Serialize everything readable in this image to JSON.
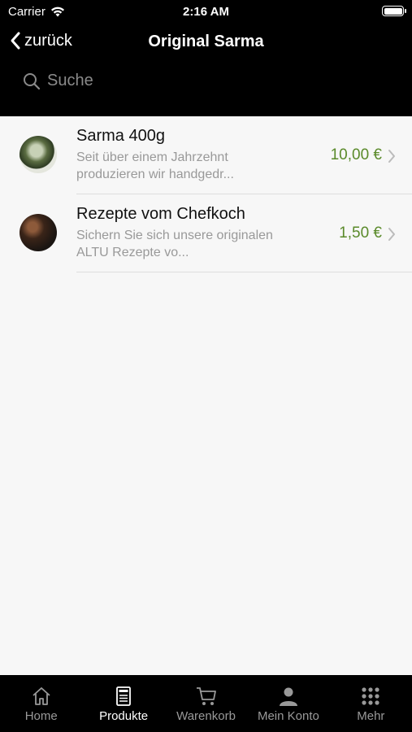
{
  "status_bar": {
    "carrier": "Carrier",
    "time": "2:16 AM",
    "battery_level": 1.0
  },
  "header": {
    "back_label": "zurück",
    "title": "Original Sarma"
  },
  "search": {
    "placeholder": "Suche",
    "value": ""
  },
  "products": [
    {
      "title": "Sarma 400g",
      "desc_line1": "Seit über einem Jahrzehnt",
      "desc_line2": "produzieren wir handgedr...",
      "price": "10,00 €"
    },
    {
      "title": "Rezepte vom Chefkoch",
      "desc_line1": "Sichern Sie sich unsere originalen",
      "desc_line2": "ALTU Rezepte vo...",
      "price": "1,50 €"
    }
  ],
  "tabs": [
    {
      "label": "Home",
      "icon": "home-icon",
      "active": false
    },
    {
      "label": "Produkte",
      "icon": "menu-card-icon",
      "active": true
    },
    {
      "label": "Warenkorb",
      "icon": "cart-icon",
      "active": false
    },
    {
      "label": "Mein Konto",
      "icon": "person-icon",
      "active": false
    },
    {
      "label": "Mehr",
      "icon": "grid-dots-icon",
      "active": false
    }
  ],
  "colors": {
    "price": "#5a8a2a",
    "header_bg": "#000000",
    "list_bg": "#f7f7f7"
  }
}
